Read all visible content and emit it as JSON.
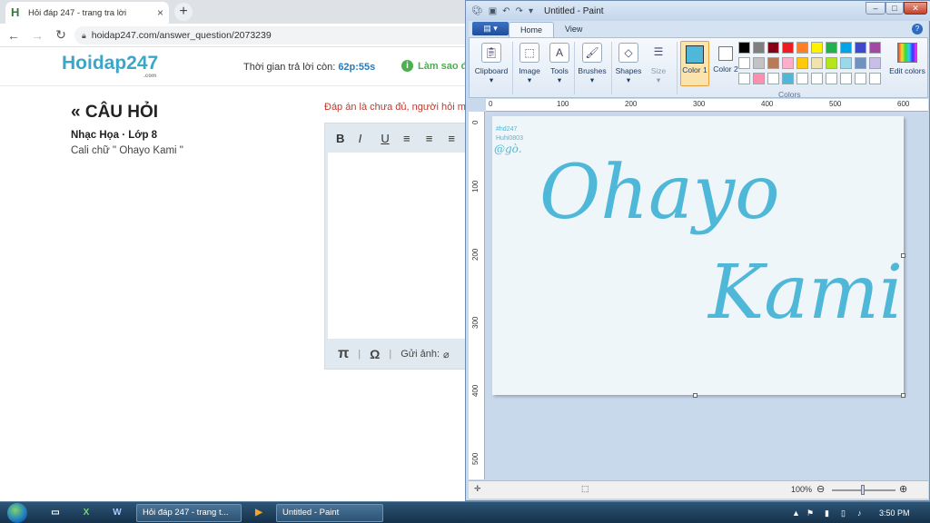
{
  "browser": {
    "tab_title": "Hỏi đáp 247 - trang tra lời",
    "tab_close": "×",
    "new_tab": "+",
    "url": "hoidap247.com/answer_question/2073239"
  },
  "site": {
    "logo": "Hoidap247",
    "logo_suffix": ".com",
    "timer_label": "Thời gian trả lời còn:",
    "timer_value": "62p:55s",
    "how_to": "Làm sao đ",
    "question_heading": "« CÂU HỎI",
    "question_meta": "Nhạc Họa · Lớp 8",
    "question_body": "Cali chữ \" Ohayo Kami \"",
    "answer_note": "Đáp án là chưa đủ, người hỏi m",
    "editor_tools": [
      "B",
      "I",
      "U",
      "≡",
      "≡",
      "≡"
    ],
    "editor_footer": {
      "pi": "π",
      "sep": "|",
      "omega": "Ω",
      "attach": "Gửi ảnh:"
    }
  },
  "paint": {
    "title": "Untitled - Paint",
    "tabs": [
      "Home",
      "View"
    ],
    "groups": {
      "clipboard": "Clipboard",
      "image": "Image",
      "tools": "Tools",
      "brushes": "Brushes",
      "shapes": "Shapes",
      "size": "Size",
      "color1": "Color 1",
      "color2": "Color 2",
      "colors": "Colors",
      "edit_colors": "Edit colors"
    },
    "ruler_top": [
      "0",
      "100",
      "200",
      "300",
      "400",
      "500",
      "600"
    ],
    "ruler_left": [
      "0",
      "100",
      "200",
      "300",
      "400",
      "500"
    ],
    "canvas": {
      "watermark": [
        "#hd247",
        "Huhi0803",
        "@gò."
      ],
      "line1": "Ohayo",
      "line2": "Kami",
      "ink_color": "#4fb8d8"
    },
    "zoom": "100%",
    "palette_row1": [
      "#000000",
      "#7f7f7f",
      "#880015",
      "#ed1c24",
      "#ff7f27",
      "#fff200",
      "#22b14c",
      "#00a2e8",
      "#3f48cc",
      "#a349a4"
    ],
    "palette_row2": [
      "#ffffff",
      "#c3c3c3",
      "#b97a57",
      "#ffaec9",
      "#ffc90e",
      "#efe4b0",
      "#b5e61d",
      "#99d9ea",
      "#7092be",
      "#c8bfe7"
    ],
    "palette_row3": [
      "#ffffff",
      "#ff8fb0",
      "#ffffff",
      "#4fb8d8",
      "#ffffff",
      "#ffffff",
      "#ffffff",
      "#ffffff",
      "#ffffff",
      "#ffffff"
    ]
  },
  "taskbar": {
    "tasks": [
      "Hỏi đáp 247 - trang t...",
      "Untitled - Paint"
    ],
    "clock": "3:50 PM"
  }
}
